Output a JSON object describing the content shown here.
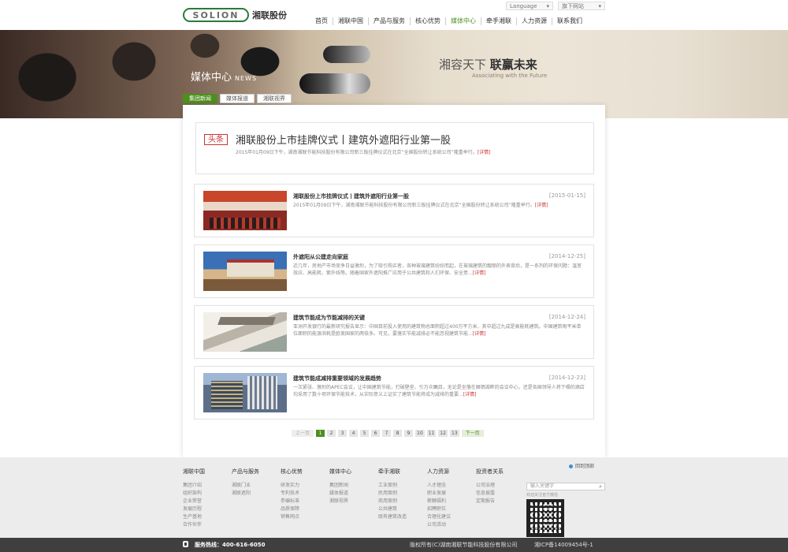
{
  "header": {
    "logo_text": "SOLION",
    "logo_cn": "湘联股份",
    "language": "Language",
    "sites": "旗下网站",
    "nav": [
      "首页",
      "湘联中国",
      "产品与服务",
      "核心优势",
      "媒体中心",
      "牵手湘联",
      "人力资源",
      "联系我们"
    ],
    "active_nav": "媒体中心"
  },
  "banner": {
    "title": "媒体中心",
    "title_en": "NEWS",
    "slogan_light": "湘容天下",
    "slogan_bold": "联赢未来",
    "slogan_en": "Associating with the Future",
    "tabs": [
      "集团新闻",
      "媒体报道",
      "湘联视界"
    ],
    "active_tab": "集团新闻"
  },
  "headline": {
    "tag": "头条",
    "title": "湘联股份上市挂牌仪式丨建筑外遮阳行业第一股",
    "desc": "2015年01月09日下午，湖南湘联节能科技股份有限公司新三板挂牌仪式在北京“全国股份转让系统公司”隆重举行。",
    "more": "[详情]"
  },
  "news": [
    {
      "title": "湘联股份上市挂牌仪式丨建筑外遮阳行业第一股",
      "date": "[2015-01-15]",
      "desc": "2015年01月09日下午，湖南湘联节能科技股份有限公司新三板挂牌仪式在北京“全国股份转让系统公司”隆重举行。",
      "more": "[详情]"
    },
    {
      "title": "外遮阳从公建走向家庭",
      "date": "[2014-12-25]",
      "desc": "近几年，房地产市场竞争日益激烈，为了吸引购买者，各种玻璃建筑纷纷而起，在玻璃建筑的靓丽的外表背后，是一系列的环保问题：温室效应、高能耗、紫外线等。随着国家外遮阳推广应用于公共建筑和人们环保、安全意...",
      "more": "[详情]"
    },
    {
      "title": "建筑节能成为节能减排的关键",
      "date": "[2014-12-24]",
      "desc": "亚洲开发银行的最新研究报告显示：中国目前投入使用的建筑物总面积超过400万平方米，其中超过九成是高能耗建筑。中国建筑每平米单位面积的能源消耗是欧美国家的两倍多。可见，要落实节能减排必不能忽视建筑节能...",
      "more": "[详情]"
    },
    {
      "title": "建筑节能成减排重要领域的发展趋势",
      "date": "[2014-12-23]",
      "desc": "一次紧张、激烈的APEC会议，让中国建筑节能，打破壁垒、引万众瞩目，无论是坐落在雁栖湖畔的会议中心，还是各国领导人将下榻的酒店均采用了数十项环保节能技术，从实际意义上证实了建筑节能将成为减排的重要...",
      "more": "[详情]"
    }
  ],
  "pager": {
    "prev": "上一页",
    "pages": [
      "1",
      "2",
      "3",
      "4",
      "5",
      "6",
      "7",
      "8",
      "9",
      "10",
      "11",
      "12",
      "13"
    ],
    "current": "1",
    "next": "下一页"
  },
  "footer": {
    "columns": [
      {
        "head": "湘联中国",
        "items": [
          "集团介绍",
          "组织架构",
          "企业荣誉",
          "发展历程",
          "生产基地",
          "合作伙伴"
        ]
      },
      {
        "head": "产品与服务",
        "items": [
          "湘联门业",
          "湘联遮阳"
        ]
      },
      {
        "head": "核心优势",
        "items": [
          "研发实力",
          "专利技术",
          "参编标准",
          "品质保障",
          "销售网点"
        ]
      },
      {
        "head": "媒体中心",
        "items": [
          "集团新闻",
          "媒体报道",
          "湘联视界"
        ]
      },
      {
        "head": "牵手湘联",
        "items": [
          "工业案例",
          "民用案例",
          "商用案例",
          "公共建筑",
          "既有建筑改造"
        ]
      },
      {
        "head": "人力资源",
        "items": [
          "人才理念",
          "职业发展",
          "薪酬福利",
          "招聘职位",
          "合理化建议",
          "公司活动"
        ]
      },
      {
        "head": "投资者关系",
        "items": [
          "公司治理",
          "信息披露",
          "定期报告"
        ]
      }
    ],
    "share": "回到顶部",
    "search_placeholder": "输入关键字",
    "note": "欢迎关注官方微信",
    "hotline_label": "服务热线：",
    "hotline": "400-616-6050",
    "copyright": "版权所有(C)湖南湘联节能科技股份有限公司",
    "icp": "湘ICP备14009454号-1"
  },
  "colors": {
    "accent": "#4d8f1e",
    "tag": "#cc3333"
  }
}
